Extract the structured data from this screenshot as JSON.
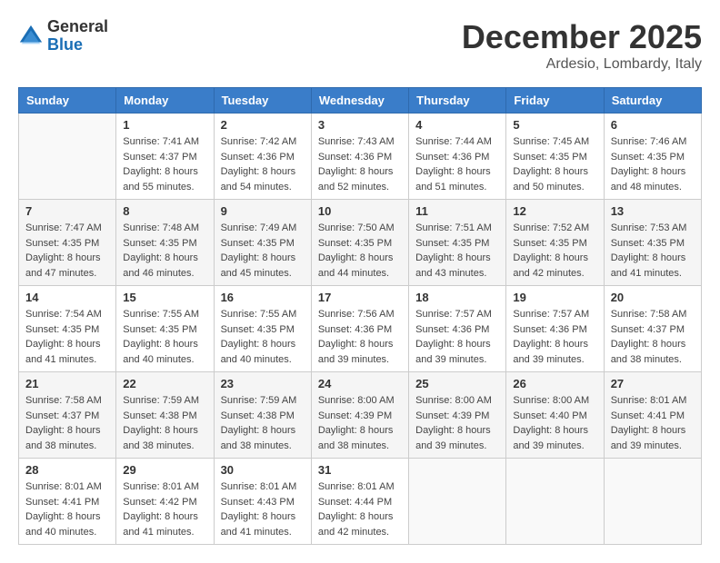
{
  "header": {
    "logo_general": "General",
    "logo_blue": "Blue",
    "month_title": "December 2025",
    "location": "Ardesio, Lombardy, Italy"
  },
  "days_of_week": [
    "Sunday",
    "Monday",
    "Tuesday",
    "Wednesday",
    "Thursday",
    "Friday",
    "Saturday"
  ],
  "weeks": [
    [
      {
        "day": "",
        "sunrise": "",
        "sunset": "",
        "daylight": ""
      },
      {
        "day": "1",
        "sunrise": "Sunrise: 7:41 AM",
        "sunset": "Sunset: 4:37 PM",
        "daylight": "Daylight: 8 hours and 55 minutes."
      },
      {
        "day": "2",
        "sunrise": "Sunrise: 7:42 AM",
        "sunset": "Sunset: 4:36 PM",
        "daylight": "Daylight: 8 hours and 54 minutes."
      },
      {
        "day": "3",
        "sunrise": "Sunrise: 7:43 AM",
        "sunset": "Sunset: 4:36 PM",
        "daylight": "Daylight: 8 hours and 52 minutes."
      },
      {
        "day": "4",
        "sunrise": "Sunrise: 7:44 AM",
        "sunset": "Sunset: 4:36 PM",
        "daylight": "Daylight: 8 hours and 51 minutes."
      },
      {
        "day": "5",
        "sunrise": "Sunrise: 7:45 AM",
        "sunset": "Sunset: 4:35 PM",
        "daylight": "Daylight: 8 hours and 50 minutes."
      },
      {
        "day": "6",
        "sunrise": "Sunrise: 7:46 AM",
        "sunset": "Sunset: 4:35 PM",
        "daylight": "Daylight: 8 hours and 48 minutes."
      }
    ],
    [
      {
        "day": "7",
        "sunrise": "Sunrise: 7:47 AM",
        "sunset": "Sunset: 4:35 PM",
        "daylight": "Daylight: 8 hours and 47 minutes."
      },
      {
        "day": "8",
        "sunrise": "Sunrise: 7:48 AM",
        "sunset": "Sunset: 4:35 PM",
        "daylight": "Daylight: 8 hours and 46 minutes."
      },
      {
        "day": "9",
        "sunrise": "Sunrise: 7:49 AM",
        "sunset": "Sunset: 4:35 PM",
        "daylight": "Daylight: 8 hours and 45 minutes."
      },
      {
        "day": "10",
        "sunrise": "Sunrise: 7:50 AM",
        "sunset": "Sunset: 4:35 PM",
        "daylight": "Daylight: 8 hours and 44 minutes."
      },
      {
        "day": "11",
        "sunrise": "Sunrise: 7:51 AM",
        "sunset": "Sunset: 4:35 PM",
        "daylight": "Daylight: 8 hours and 43 minutes."
      },
      {
        "day": "12",
        "sunrise": "Sunrise: 7:52 AM",
        "sunset": "Sunset: 4:35 PM",
        "daylight": "Daylight: 8 hours and 42 minutes."
      },
      {
        "day": "13",
        "sunrise": "Sunrise: 7:53 AM",
        "sunset": "Sunset: 4:35 PM",
        "daylight": "Daylight: 8 hours and 41 minutes."
      }
    ],
    [
      {
        "day": "14",
        "sunrise": "Sunrise: 7:54 AM",
        "sunset": "Sunset: 4:35 PM",
        "daylight": "Daylight: 8 hours and 41 minutes."
      },
      {
        "day": "15",
        "sunrise": "Sunrise: 7:55 AM",
        "sunset": "Sunset: 4:35 PM",
        "daylight": "Daylight: 8 hours and 40 minutes."
      },
      {
        "day": "16",
        "sunrise": "Sunrise: 7:55 AM",
        "sunset": "Sunset: 4:35 PM",
        "daylight": "Daylight: 8 hours and 40 minutes."
      },
      {
        "day": "17",
        "sunrise": "Sunrise: 7:56 AM",
        "sunset": "Sunset: 4:36 PM",
        "daylight": "Daylight: 8 hours and 39 minutes."
      },
      {
        "day": "18",
        "sunrise": "Sunrise: 7:57 AM",
        "sunset": "Sunset: 4:36 PM",
        "daylight": "Daylight: 8 hours and 39 minutes."
      },
      {
        "day": "19",
        "sunrise": "Sunrise: 7:57 AM",
        "sunset": "Sunset: 4:36 PM",
        "daylight": "Daylight: 8 hours and 39 minutes."
      },
      {
        "day": "20",
        "sunrise": "Sunrise: 7:58 AM",
        "sunset": "Sunset: 4:37 PM",
        "daylight": "Daylight: 8 hours and 38 minutes."
      }
    ],
    [
      {
        "day": "21",
        "sunrise": "Sunrise: 7:58 AM",
        "sunset": "Sunset: 4:37 PM",
        "daylight": "Daylight: 8 hours and 38 minutes."
      },
      {
        "day": "22",
        "sunrise": "Sunrise: 7:59 AM",
        "sunset": "Sunset: 4:38 PM",
        "daylight": "Daylight: 8 hours and 38 minutes."
      },
      {
        "day": "23",
        "sunrise": "Sunrise: 7:59 AM",
        "sunset": "Sunset: 4:38 PM",
        "daylight": "Daylight: 8 hours and 38 minutes."
      },
      {
        "day": "24",
        "sunrise": "Sunrise: 8:00 AM",
        "sunset": "Sunset: 4:39 PM",
        "daylight": "Daylight: 8 hours and 38 minutes."
      },
      {
        "day": "25",
        "sunrise": "Sunrise: 8:00 AM",
        "sunset": "Sunset: 4:39 PM",
        "daylight": "Daylight: 8 hours and 39 minutes."
      },
      {
        "day": "26",
        "sunrise": "Sunrise: 8:00 AM",
        "sunset": "Sunset: 4:40 PM",
        "daylight": "Daylight: 8 hours and 39 minutes."
      },
      {
        "day": "27",
        "sunrise": "Sunrise: 8:01 AM",
        "sunset": "Sunset: 4:41 PM",
        "daylight": "Daylight: 8 hours and 39 minutes."
      }
    ],
    [
      {
        "day": "28",
        "sunrise": "Sunrise: 8:01 AM",
        "sunset": "Sunset: 4:41 PM",
        "daylight": "Daylight: 8 hours and 40 minutes."
      },
      {
        "day": "29",
        "sunrise": "Sunrise: 8:01 AM",
        "sunset": "Sunset: 4:42 PM",
        "daylight": "Daylight: 8 hours and 41 minutes."
      },
      {
        "day": "30",
        "sunrise": "Sunrise: 8:01 AM",
        "sunset": "Sunset: 4:43 PM",
        "daylight": "Daylight: 8 hours and 41 minutes."
      },
      {
        "day": "31",
        "sunrise": "Sunrise: 8:01 AM",
        "sunset": "Sunset: 4:44 PM",
        "daylight": "Daylight: 8 hours and 42 minutes."
      },
      {
        "day": "",
        "sunrise": "",
        "sunset": "",
        "daylight": ""
      },
      {
        "day": "",
        "sunrise": "",
        "sunset": "",
        "daylight": ""
      },
      {
        "day": "",
        "sunrise": "",
        "sunset": "",
        "daylight": ""
      }
    ]
  ]
}
